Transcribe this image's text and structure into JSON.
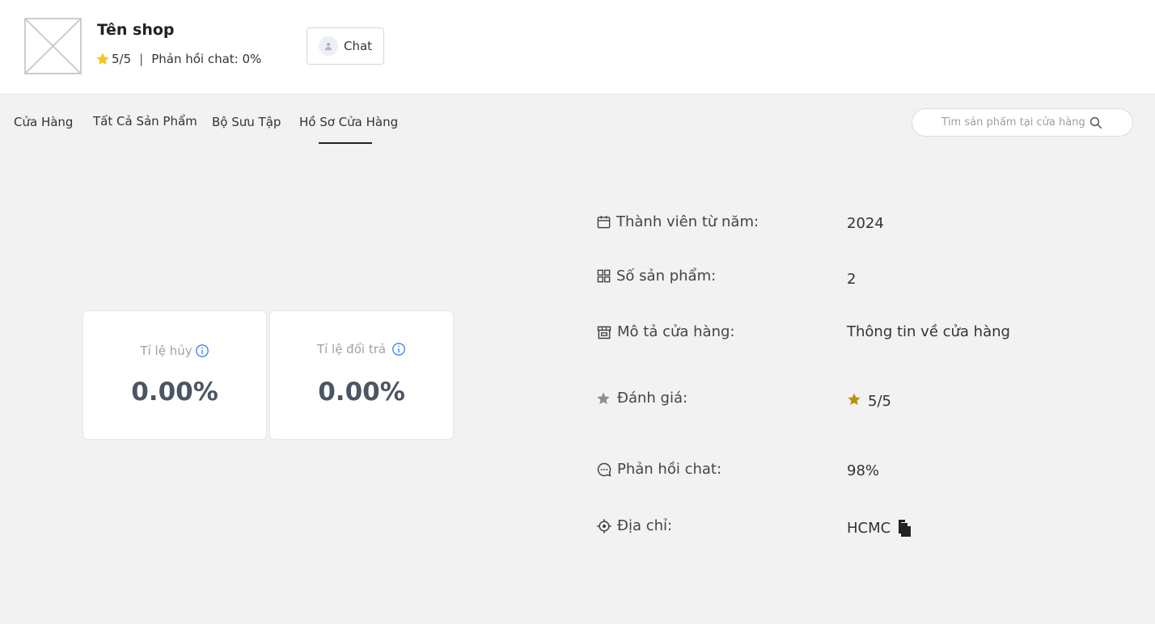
{
  "header": {
    "shop_name": "Tên shop",
    "rating": "5/5",
    "separator": "|",
    "chat_response": "Phản hồi chat: 0%",
    "chat_button": "Chat"
  },
  "nav": {
    "tabs": [
      {
        "label": "Cửa Hàng"
      },
      {
        "label": "Tất Cả Sản Phẩm"
      },
      {
        "label": "Bộ Sưu Tập"
      },
      {
        "label": "Hồ Sơ Cửa Hàng"
      }
    ],
    "active_tab": "Hồ Sơ Cửa Hàng"
  },
  "search": {
    "placeholder": "Tìm sản phẩm tại cửa hàng"
  },
  "stats": {
    "cancel_rate": {
      "label": "Tỉ lệ hủy",
      "value": "0.00%"
    },
    "return_rate": {
      "label": "Tỉ lệ đổi trả",
      "value": "0.00%"
    }
  },
  "info": {
    "member_since": {
      "label": "Thành viên từ năm:",
      "value": "2024"
    },
    "product_count": {
      "label": "Số sản phẩm:",
      "value": "2"
    },
    "description": {
      "label": "Mô tả cửa hàng:",
      "value": "Thông tin về cửa hàng"
    },
    "rating": {
      "label": "Đánh giá:",
      "value": "5/5"
    },
    "chat_response": {
      "label": "Phản hồi chat:",
      "value": "98%"
    },
    "address": {
      "label": "Địa chỉ:",
      "value": "HCMC"
    }
  },
  "colors": {
    "star_header": "#f5c518",
    "star_rating": "#b8960c",
    "info_icon": "#3b82f6",
    "active_underline": "#222222"
  },
  "icons": [
    "image-placeholder-icon",
    "star-icon",
    "user-icon",
    "search-icon",
    "info-icon",
    "calendar-icon",
    "grid-icon",
    "store-icon",
    "chat-bubble-icon",
    "location-icon",
    "copy-icon"
  ]
}
